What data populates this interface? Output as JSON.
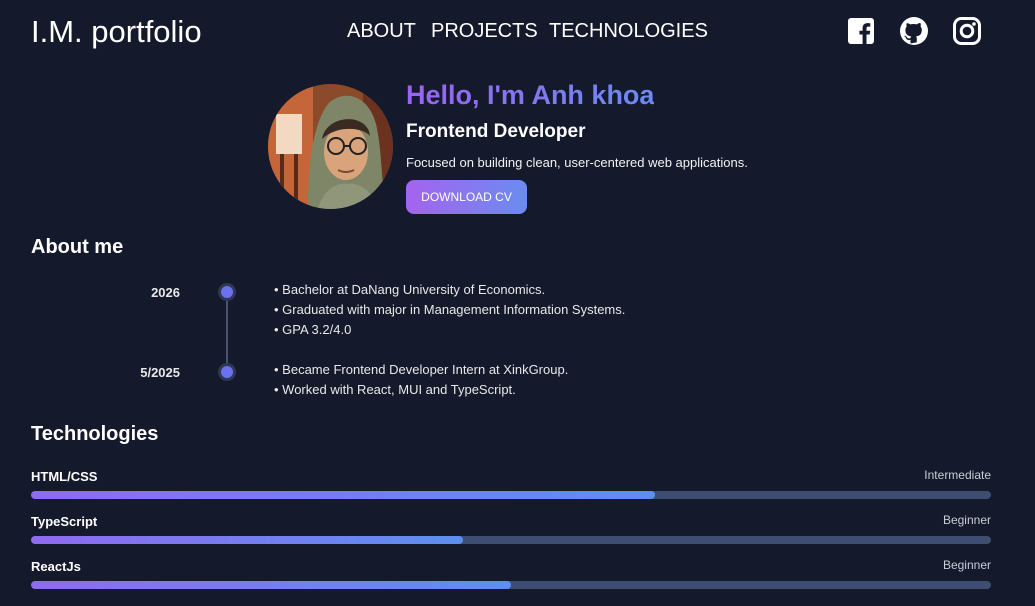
{
  "header": {
    "brand": "I.M. portfolio",
    "nav": [
      {
        "label": "ABOUT"
      },
      {
        "label": "PROJECTS"
      },
      {
        "label": "TECHNOLOGIES"
      }
    ],
    "social": [
      {
        "icon": "facebook-icon"
      },
      {
        "icon": "github-icon"
      },
      {
        "icon": "instagram-icon"
      }
    ]
  },
  "hero": {
    "greeting": "Hello, I'm Anh khoa",
    "role": "Frontend Developer",
    "tagline": "Focused on building clean, user-centered web applications.",
    "cv_button": "DOWNLOAD CV"
  },
  "about": {
    "title": "About me",
    "timeline": [
      {
        "year": "2026",
        "items": [
          "• Bachelor at DaNang University of Economics.",
          "• Graduated with major in Management Information Systems.",
          "• GPA 3.2/4.0"
        ]
      },
      {
        "year": "5/2025",
        "items": [
          "• Became Frontend Developer Intern at XinkGroup.",
          "• Worked with React, MUI and TypeScript."
        ]
      }
    ]
  },
  "technologies": {
    "title": "Technologies",
    "skills": [
      {
        "name": "HTML/CSS",
        "level": "Intermediate",
        "progress": 0.65
      },
      {
        "name": "TypeScript",
        "level": "Beginner",
        "progress": 0.45
      },
      {
        "name": "ReactJs",
        "level": "Beginner",
        "progress": 0.5
      }
    ]
  },
  "colors": {
    "background": "#141a2b",
    "accent_start": "#9b63f2",
    "accent_end": "#6a8cf0",
    "bar_track": "#3d4e72"
  }
}
